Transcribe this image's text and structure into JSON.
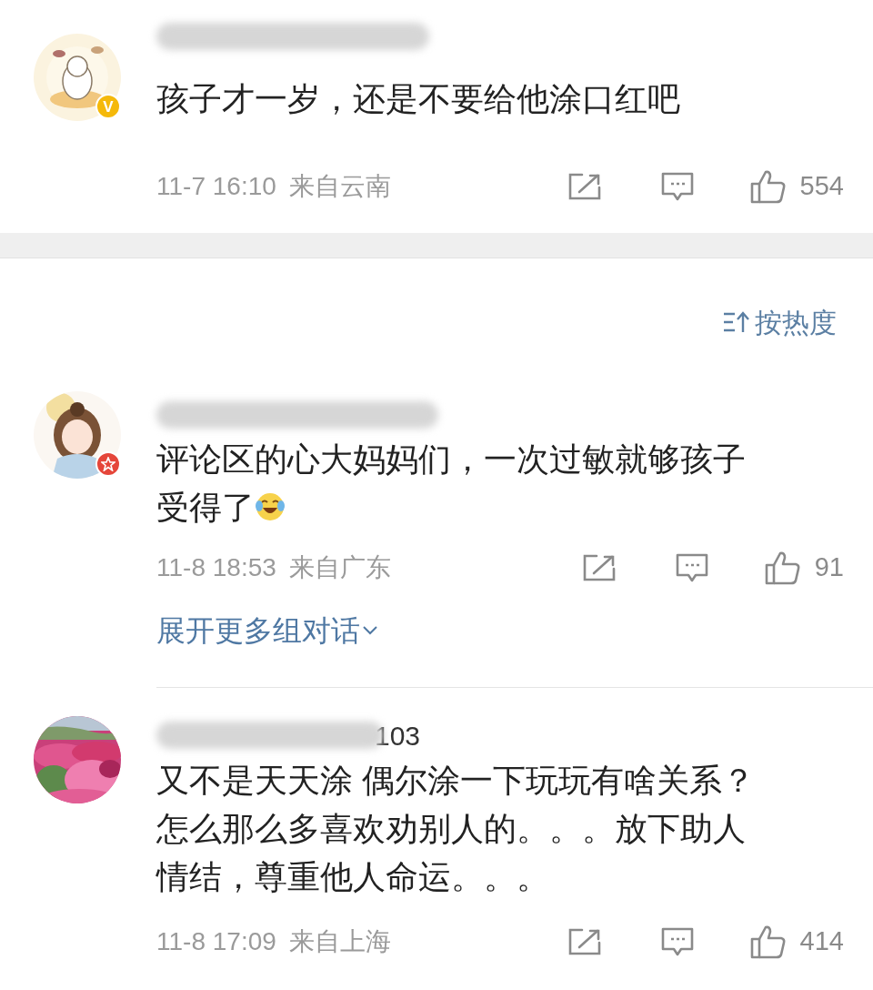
{
  "comments": [
    {
      "badge": {
        "kind": "verified",
        "text": "V"
      },
      "lines": [
        "孩子才一岁，还是不要给他涂口红吧"
      ],
      "time": "11-7 16:10",
      "location": "来自云南",
      "likes": "554"
    },
    {
      "badge": {
        "kind": "star"
      },
      "lines": [
        "评论区的心大妈妈们，一次过敏就够孩子",
        "受得了"
      ],
      "emoji": true,
      "time": "11-8 18:53",
      "location": "来自广东",
      "likes": "91",
      "expand": "展开更多组对话"
    },
    {
      "name_tail": "103",
      "lines": [
        "又不是天天涂 偶尔涂一下玩玩有啥关系？",
        "怎么那么多喜欢劝别人的。。。放下助人",
        "情结，尊重他人命运。。。"
      ],
      "time": "11-8 17:09",
      "location": "来自上海",
      "likes": "414"
    }
  ],
  "sort": {
    "label": "按热度"
  }
}
